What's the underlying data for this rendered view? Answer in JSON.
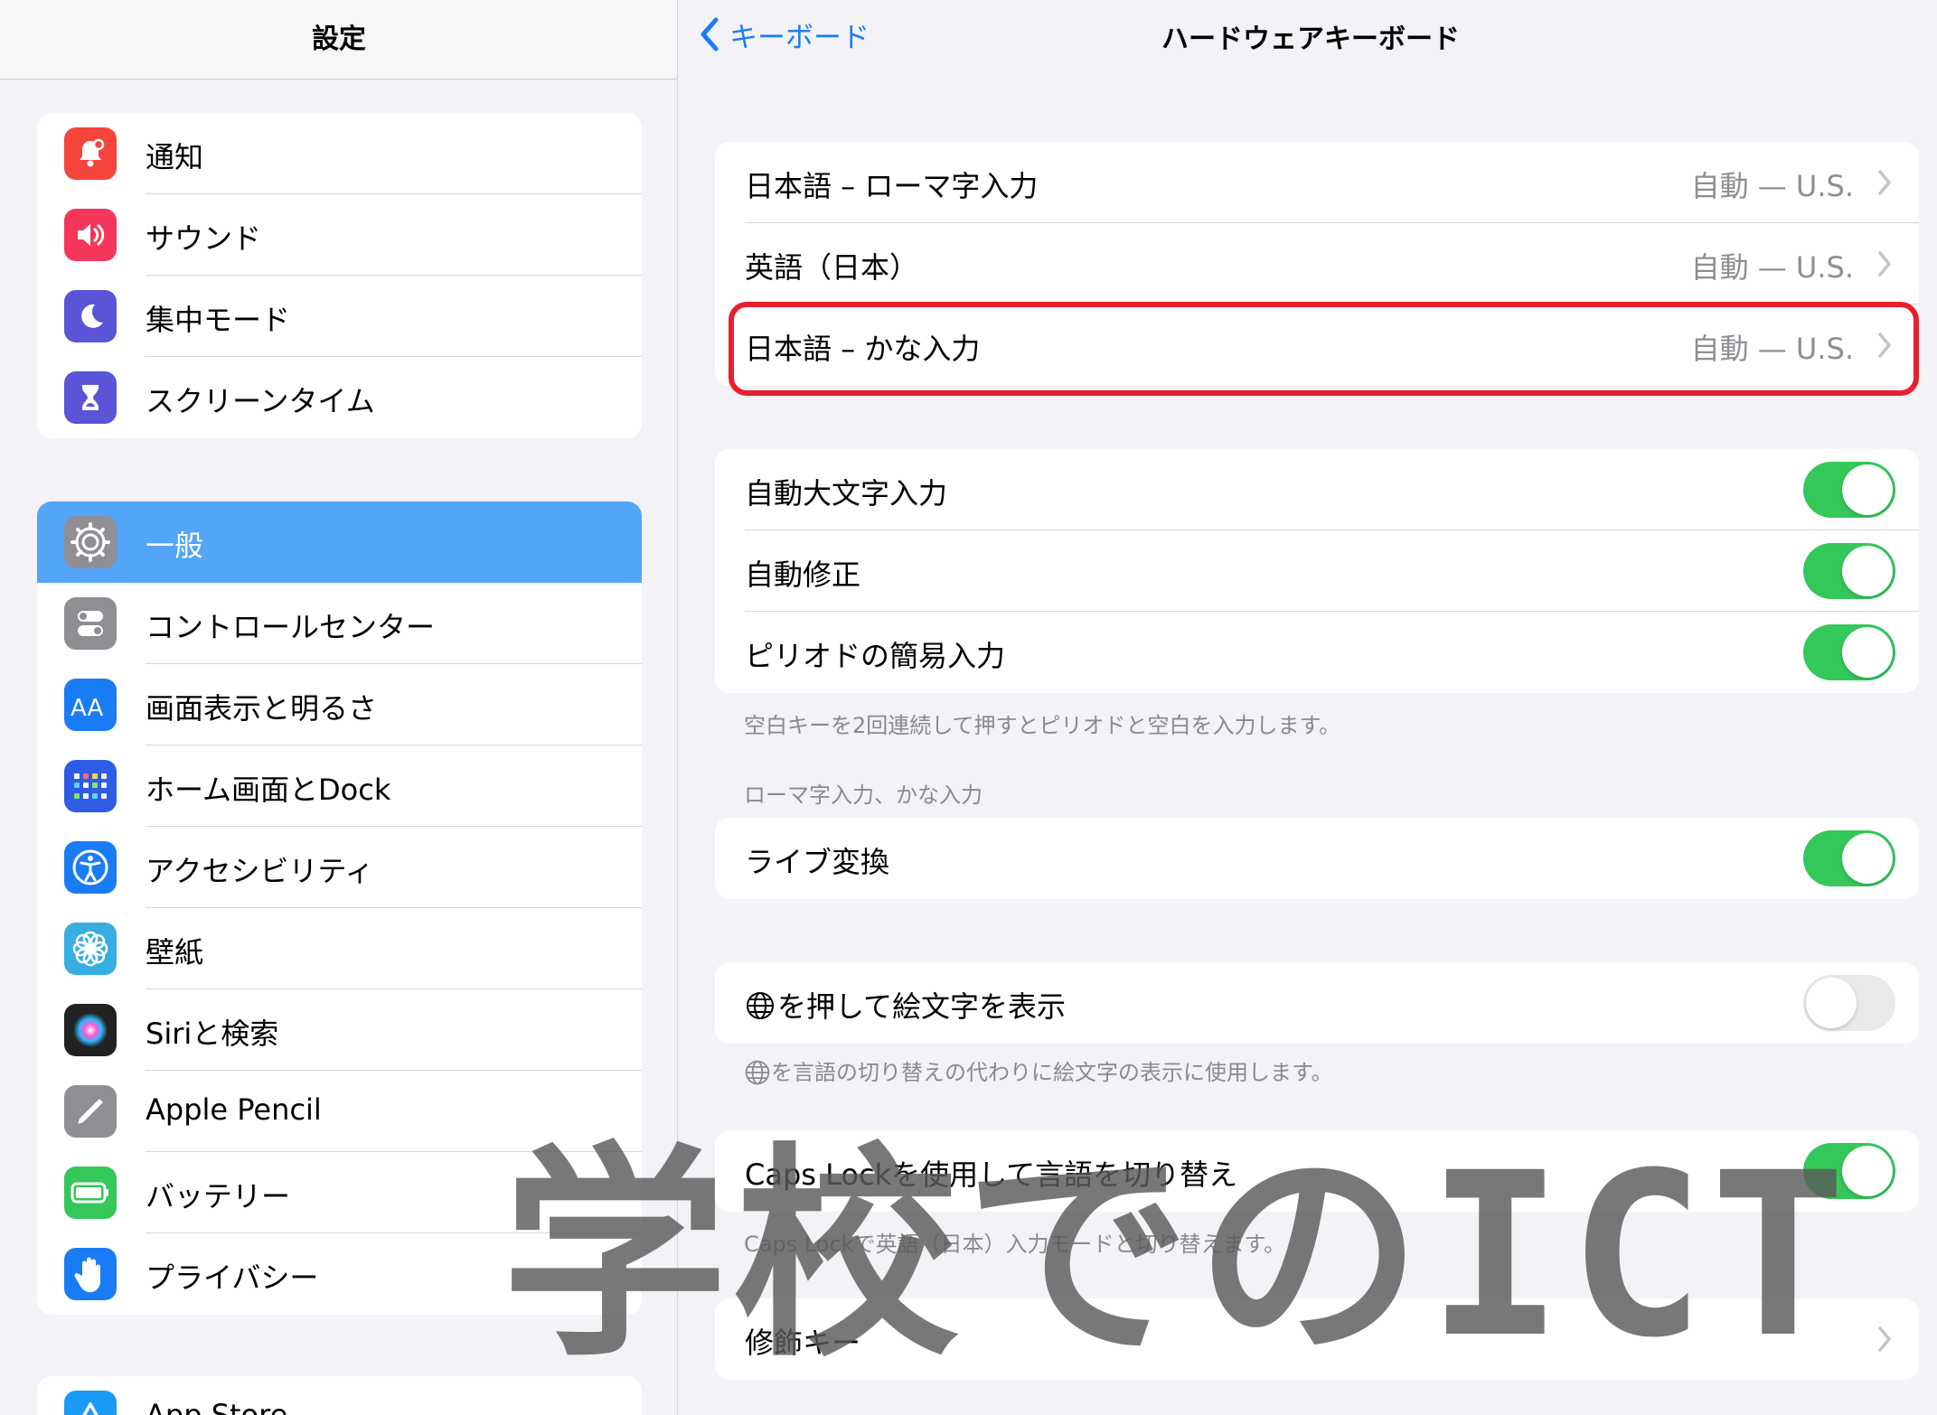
{
  "sidebar": {
    "title": "設定",
    "groups": [
      {
        "items": [
          {
            "label": "通知",
            "icon": "bell-icon",
            "color": "#f5453d"
          },
          {
            "label": "サウンド",
            "icon": "speaker-icon",
            "color": "#f4365c"
          },
          {
            "label": "集中モード",
            "icon": "moon-icon",
            "color": "#5a54d6"
          },
          {
            "label": "スクリーンタイム",
            "icon": "hourglass-icon",
            "color": "#5a54d6"
          }
        ]
      },
      {
        "items": [
          {
            "label": "一般",
            "icon": "gear-icon",
            "color": "#8e8e93",
            "selected": true
          },
          {
            "label": "コントロールセンター",
            "icon": "switches-icon",
            "color": "#8e8e93"
          },
          {
            "label": "画面表示と明るさ",
            "icon": "text-size-icon",
            "color": "#1a7cf5"
          },
          {
            "label": "ホーム画面とDock",
            "icon": "home-grid-icon",
            "color": "#2f5ce6"
          },
          {
            "label": "アクセシビリティ",
            "icon": "accessibility-icon",
            "color": "#1a7cf5"
          },
          {
            "label": "壁紙",
            "icon": "flower-icon",
            "color": "#37aee2"
          },
          {
            "label": "Siriと検索",
            "icon": "siri-icon",
            "color": "#222222"
          },
          {
            "label": "Apple Pencil",
            "icon": "pencil-icon",
            "color": "#8e8e93"
          },
          {
            "label": "バッテリー",
            "icon": "battery-icon",
            "color": "#34c759"
          },
          {
            "label": "プライバシー",
            "icon": "hand-icon",
            "color": "#1a7cf5"
          }
        ]
      },
      {
        "items": [
          {
            "label": "App Store",
            "icon": "app-store-icon",
            "color": "#1a9bf5"
          }
        ]
      }
    ]
  },
  "nav": {
    "back_label": "キーボード",
    "title": "ハードウェアキーボード"
  },
  "layouts": [
    {
      "label": "日本語 – ローマ字入力",
      "value": "自動 — U.S."
    },
    {
      "label": "英語（日本）",
      "value": "自動 — U.S."
    },
    {
      "label": "日本語 – かな入力",
      "value": "自動 — U.S."
    }
  ],
  "typing": [
    {
      "label": "自動大文字入力",
      "on": true
    },
    {
      "label": "自動修正",
      "on": true
    },
    {
      "label": "ピリオドの簡易入力",
      "on": true
    }
  ],
  "typing_footer": "空白キーを2回連続して押すとピリオドと空白を入力します。",
  "romaji_header": "ローマ字入力、かな入力",
  "live": {
    "label": "ライブ変換",
    "on": true
  },
  "globe": {
    "label": "を押して絵文字を表示",
    "on": false,
    "footer": "を言語の切り替えの代わりに絵文字の表示に使用します。"
  },
  "caps": {
    "label": "Caps Lockを使用して言語を切り替え",
    "on": true,
    "footer": "Caps Lockで英語（日本）入力モードと切り替えます。"
  },
  "modifier": {
    "label": "修飾キー"
  },
  "watermark": "学校でのICT",
  "colors": {
    "accent": "#1a7cf5",
    "toggle_on": "#34c759",
    "highlight": "#e8202e",
    "selected_row": "#52a5f8"
  }
}
